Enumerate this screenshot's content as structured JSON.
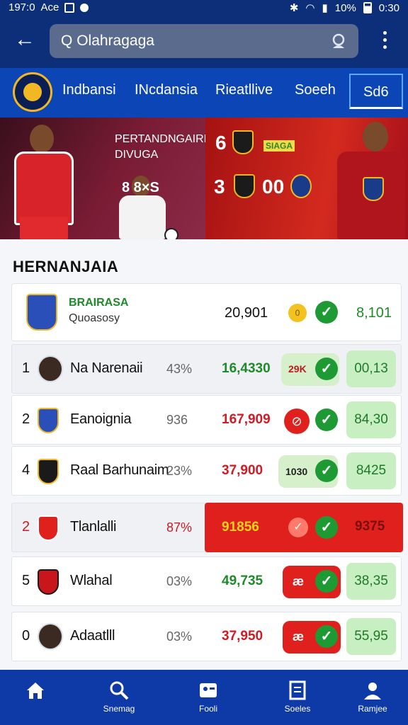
{
  "status_bar": {
    "time": "197:0",
    "carrier": "Ace",
    "battery": "10%",
    "clock": "0:30"
  },
  "search": {
    "value": "Olahragaga"
  },
  "nav": {
    "tabs": [
      {
        "label": "Indbansi"
      },
      {
        "label": "INcdansia"
      },
      {
        "label": "Rieatllive"
      },
      {
        "label": "Soeeh"
      },
      {
        "label": "Sd6"
      }
    ],
    "active_tab": "Sd6"
  },
  "banner": {
    "title": "PERTANDNGAIRE DIVUGA",
    "vs": "8 8×S",
    "score_top": "6",
    "score_bottom_left": "3",
    "score_bottom_right": "00",
    "tag": "SIAGA"
  },
  "section": {
    "title": "HERNANJAIA"
  },
  "featured": {
    "name": "BRAIRASA",
    "subtitle": "Quoasosy",
    "value": "20,901",
    "coin_label": "0",
    "score": "8,101"
  },
  "rows": [
    {
      "rank": "1",
      "name": "Na Narenaii",
      "pct": "43%",
      "num": "16,4330",
      "num_color": "green",
      "pill": "29K",
      "pill_style": "light",
      "score": "00,13",
      "avatar": "person"
    },
    {
      "rank": "2",
      "name": "Eanoignia",
      "pct": "936",
      "num": "167,909",
      "num_color": "red",
      "pill": "",
      "pill_style": "red-icon",
      "score": "84,30",
      "avatar": "badge-blue"
    },
    {
      "rank": "4",
      "name": "Raal Barhunaim",
      "pct": "23%",
      "num": "37,900",
      "num_color": "red",
      "pill": "1030",
      "pill_style": "light",
      "score": "8425",
      "avatar": "badge-dark"
    },
    {
      "rank": "2",
      "name": "Tlanlalli",
      "pct": "87%",
      "num": "91856",
      "num_color": "yellow",
      "pill": "",
      "pill_style": "red-row",
      "score": "9375",
      "avatar": "badge-red"
    },
    {
      "rank": "5",
      "name": "Wlahal",
      "pct": "03%",
      "num": "49,735",
      "num_color": "green",
      "pill": "æ",
      "pill_style": "red",
      "score": "38,35",
      "avatar": "badge-black"
    },
    {
      "rank": "0",
      "name": "Adaatlll",
      "pct": "03%",
      "num": "37,950",
      "num_color": "red",
      "pill": "æ",
      "pill_style": "red",
      "score": "55,95",
      "avatar": "person"
    }
  ],
  "bottom_nav": [
    {
      "label": "",
      "icon": "home-icon"
    },
    {
      "label": "Snemag",
      "icon": "search-icon"
    },
    {
      "label": "Fooli",
      "icon": "id-card-icon"
    },
    {
      "label": "Soeles",
      "icon": "document-icon"
    },
    {
      "label": "Ramjee",
      "icon": "profile-icon"
    }
  ],
  "colors": {
    "header": "#0d2f7a",
    "tabs": "#0c45b5",
    "green": "#1e8a2a",
    "red": "#d11a24"
  }
}
